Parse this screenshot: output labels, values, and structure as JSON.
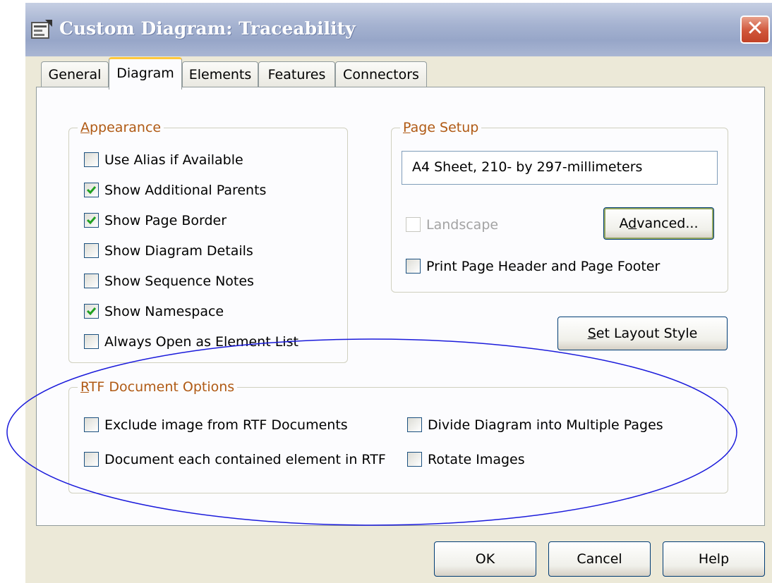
{
  "window": {
    "title": "Custom Diagram: Traceability",
    "close_symbol": "✕",
    "title_icon": "diagram-properties-icon"
  },
  "tabs": [
    {
      "label": "General",
      "active": false
    },
    {
      "label": "Diagram",
      "active": true
    },
    {
      "label": "Elements",
      "active": false
    },
    {
      "label": "Features",
      "active": false
    },
    {
      "label": "Connectors",
      "active": false
    }
  ],
  "appearance": {
    "legend_first": "A",
    "legend_rest": "ppearance",
    "options": [
      {
        "label": "Use Alias if Available",
        "checked": false
      },
      {
        "label": "Show Additional Parents",
        "checked": true
      },
      {
        "label": "Show Page Border",
        "checked": true
      },
      {
        "label": "Show Diagram Details",
        "checked": false
      },
      {
        "label": "Show Sequence Notes",
        "checked": false
      },
      {
        "label": "Show Namespace",
        "checked": true
      },
      {
        "label": "Always Open as Element List",
        "checked": false
      }
    ]
  },
  "page_setup": {
    "legend_first": "P",
    "legend_rest": "age Setup",
    "page_size": "A4 Sheet, 210- by 297-millimeters",
    "landscape": {
      "label": "Landscape",
      "checked": false,
      "enabled": false
    },
    "advanced_pre": "A",
    "advanced_u": "d",
    "advanced_post": "vanced...",
    "print_header": {
      "label": "Print Page Header and Page Footer",
      "checked": false
    }
  },
  "layout_button": {
    "u": "S",
    "rest": "et Layout Style"
  },
  "rtf": {
    "legend_first": "R",
    "legend_rest": "TF Document Options",
    "options": [
      {
        "label": "Exclude image from RTF Documents",
        "checked": false
      },
      {
        "label": "Document each contained element in RTF",
        "checked": false
      },
      {
        "label": "Divide Diagram into Multiple Pages",
        "checked": false
      },
      {
        "label": "Rotate Images",
        "checked": false
      }
    ]
  },
  "buttons": {
    "ok": "OK",
    "cancel": "Cancel",
    "help": "Help"
  },
  "colors": {
    "group_label": "#b05a14",
    "check": "#21a121",
    "annotation_ellipse": "#1a1adb"
  }
}
